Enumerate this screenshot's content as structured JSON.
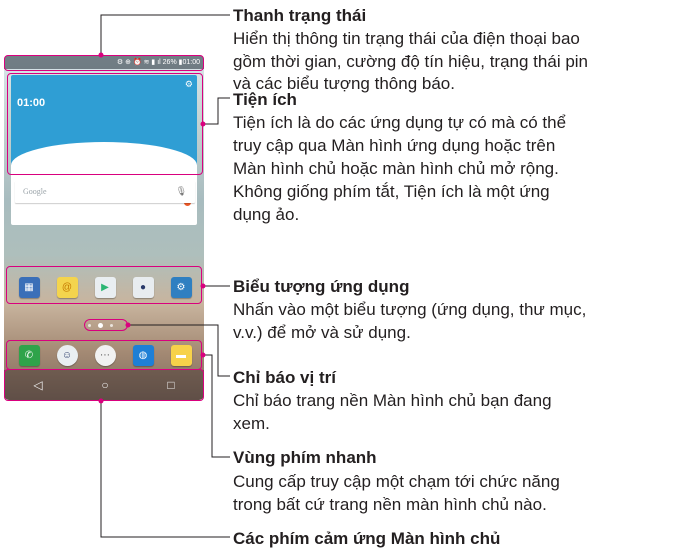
{
  "phone": {
    "status_icons": "⚙ ⊕ ⏰ ≋ ▮ ıl 26% ▮01:00",
    "clock": "01:00",
    "badge_count": "3",
    "search_placeholder": "Google",
    "apps": [
      "apps-folder-icon",
      "email-icon",
      "play-store-icon",
      "camera-icon",
      "settings-icon"
    ],
    "dock": [
      "phone-icon",
      "contacts-icon",
      "apps-icon",
      "browser-icon",
      "messaging-icon"
    ],
    "nav": [
      "◁",
      "○",
      "□"
    ]
  },
  "sections": [
    {
      "title": "Thanh trạng thái",
      "lines": [
        "Hiển thị thông tin trạng thái của điện thoại bao",
        "gồm thời gian, cường độ tín hiệu, trạng thái pin",
        "và các biểu tượng thông báo."
      ]
    },
    {
      "title": "Tiện ích",
      "lines": [
        "Tiện ích là do các ứng dụng tự có mà có thể",
        "truy cập qua Màn hình ứng dụng hoặc trên",
        "Màn hình chủ hoặc màn hình chủ mở rộng.",
        "Không giống phím tắt, Tiện ích là một ứng",
        "dụng ảo."
      ]
    },
    {
      "title": "Biểu tượng ứng dụng",
      "lines": [
        "Nhấn vào một biểu tượng (ứng dụng, thư mục,",
        "v.v.) để mở và sử dụng."
      ]
    },
    {
      "title": "Chỉ báo vị trí",
      "lines": [
        "Chỉ báo trang nền Màn hình chủ bạn đang",
        "xem."
      ]
    },
    {
      "title": "Vùng phím nhanh",
      "lines": [
        "Cung cấp truy cập một chạm tới chức năng",
        "trong bất cứ trang nền màn hình chủ nào."
      ]
    },
    {
      "title": "Các phím cảm ứng Màn hình chủ",
      "lines": []
    }
  ]
}
